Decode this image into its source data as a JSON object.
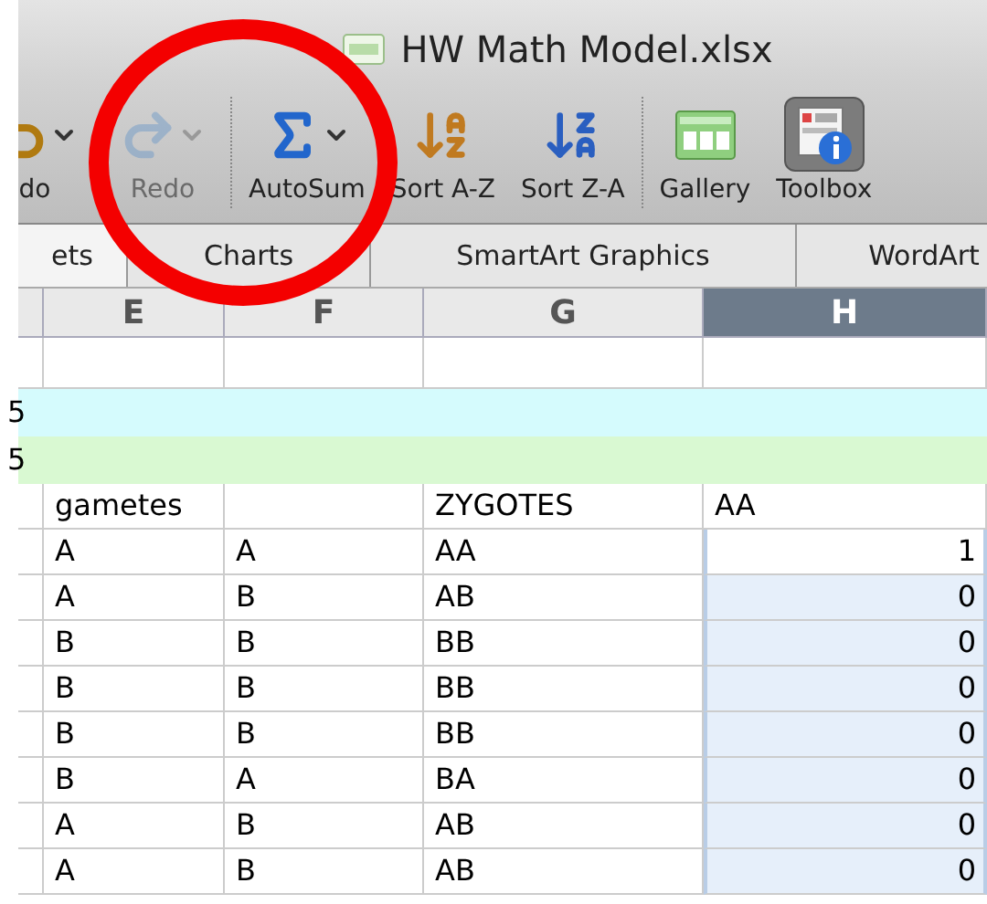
{
  "window": {
    "title": "HW Math Model.xlsx"
  },
  "toolbar_groups": [
    [
      {
        "kind": "undo",
        "label": "do",
        "disabled": false,
        "selected": false,
        "dropdown": true
      },
      {
        "kind": "redo",
        "label": "Redo",
        "disabled": true,
        "selected": false,
        "dropdown": true
      }
    ],
    [
      {
        "kind": "autosum",
        "label": "AutoSum",
        "disabled": false,
        "selected": false,
        "dropdown": true
      },
      {
        "kind": "sort_az",
        "label": "Sort A-Z",
        "disabled": false,
        "selected": false,
        "dropdown": false
      },
      {
        "kind": "sort_za",
        "label": "Sort Z-A",
        "disabled": false,
        "selected": false,
        "dropdown": false
      }
    ],
    [
      {
        "kind": "gallery",
        "label": "Gallery",
        "disabled": false,
        "selected": false,
        "dropdown": false
      },
      {
        "kind": "toolbox",
        "label": "Toolbox",
        "disabled": false,
        "selected": true,
        "dropdown": false
      }
    ]
  ],
  "ribbon_tabs": [
    {
      "label": "ets",
      "selected": true
    },
    {
      "label": "Charts",
      "selected": false
    },
    {
      "label": "SmartArt Graphics",
      "selected": false
    },
    {
      "label": "WordArt",
      "selected": false
    }
  ],
  "sheet": {
    "columns": [
      {
        "label": "E",
        "selected": false
      },
      {
        "label": "F",
        "selected": false
      },
      {
        "label": "G",
        "selected": false
      },
      {
        "label": "H",
        "selected": true
      }
    ],
    "rows": [
      {
        "kind": "blank",
        "row_label": "",
        "cells": [
          "",
          "",
          "",
          ""
        ]
      },
      {
        "kind": "band",
        "row_label": "5",
        "color": "#d5fbfd"
      },
      {
        "kind": "band",
        "row_label": "5",
        "color": "#d9f9d2"
      },
      {
        "kind": "text",
        "row_label": "",
        "cells": [
          "gametes",
          "",
          "ZYGOTES",
          "AA"
        ]
      },
      {
        "kind": "number",
        "row_label": "",
        "cells": [
          "A",
          "A",
          "AA",
          "1"
        ],
        "selected": true,
        "active": true
      },
      {
        "kind": "number",
        "row_label": "",
        "cells": [
          "A",
          "B",
          "AB",
          "0"
        ],
        "selected": true,
        "active": false
      },
      {
        "kind": "number",
        "row_label": "",
        "cells": [
          "B",
          "B",
          "BB",
          "0"
        ],
        "selected": true,
        "active": false
      },
      {
        "kind": "number",
        "row_label": "",
        "cells": [
          "B",
          "B",
          "BB",
          "0"
        ],
        "selected": true,
        "active": false
      },
      {
        "kind": "number",
        "row_label": "",
        "cells": [
          "B",
          "B",
          "BB",
          "0"
        ],
        "selected": true,
        "active": false
      },
      {
        "kind": "number",
        "row_label": "",
        "cells": [
          "B",
          "A",
          "BA",
          "0"
        ],
        "selected": true,
        "active": false
      },
      {
        "kind": "number",
        "row_label": "",
        "cells": [
          "A",
          "B",
          "AB",
          "0"
        ],
        "selected": true,
        "active": false
      },
      {
        "kind": "number",
        "row_label": "",
        "cells": [
          "A",
          "B",
          "AB",
          "0"
        ],
        "selected": true,
        "active": false
      }
    ]
  },
  "annotations": [
    {
      "kind": "ellipse"
    }
  ]
}
